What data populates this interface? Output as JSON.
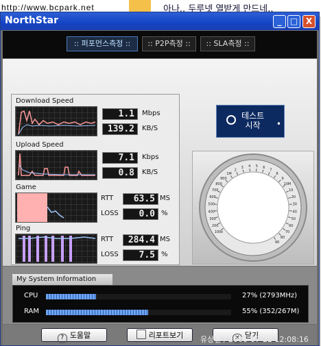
{
  "background": {
    "url_text": "http://www.bcpark.net",
    "headline": "아나.. 두루넷 열받게 만드네.."
  },
  "window": {
    "title": "NorthStar",
    "buttons": {
      "minimize": "_",
      "maximize": "□",
      "close": "X"
    }
  },
  "tabs": [
    {
      "label": ":: 퍼포먼스측정 ::",
      "active": true
    },
    {
      "label": ":: P2P측정 ::",
      "active": false
    },
    {
      "label": ":: SLA측정 ::",
      "active": false
    }
  ],
  "metrics": {
    "download": {
      "label": "Download Speed",
      "value1": "1.1",
      "unit1": "Mbps",
      "value2": "139.2",
      "unit2": "KB/S"
    },
    "upload": {
      "label": "Upload Speed",
      "value1": "7.1",
      "unit1": "Kbps",
      "value2": "0.8",
      "unit2": "KB/S"
    },
    "game": {
      "label": "Game",
      "rtt_label": "RTT",
      "rtt": "63.5",
      "rtt_unit": "MS",
      "loss_label": "LOSS",
      "loss": "0.0",
      "loss_unit": "%"
    },
    "ping": {
      "label": "Ping",
      "rtt_label": "RTT",
      "rtt": "284.4",
      "rtt_unit": "MS",
      "loss_label": "LOSS",
      "loss": "7.5",
      "loss_unit": "%"
    }
  },
  "start_button": {
    "line1": "테스트",
    "line2": "시작"
  },
  "gauge": {
    "ticks": [
      "100k",
      "200",
      "300",
      "400",
      "500",
      "600",
      "700",
      "800",
      "900",
      "1M",
      "2",
      "3",
      "4",
      "5",
      "6",
      "7",
      "8",
      "9",
      "10M",
      "10",
      "20",
      "30",
      "40",
      "50",
      "60",
      "70",
      "80",
      "90"
    ]
  },
  "system_info": {
    "title": "My System Information",
    "rows": [
      {
        "name": "CPU",
        "value": "27% (2793MHz)",
        "percent": 27
      },
      {
        "name": "RAM",
        "value": "55% (352/267M)",
        "percent": 55
      }
    ]
  },
  "footer": {
    "help": "도움말",
    "report": "리포트보기",
    "close": "닫기",
    "stamp": "유상철 / 2006-07-22 12:08:16"
  },
  "colors": {
    "titlebar": "#1444c4",
    "lcd": "#151515",
    "bar_fill": "#6fa4f0",
    "graph_line": "#ff9a9a"
  }
}
